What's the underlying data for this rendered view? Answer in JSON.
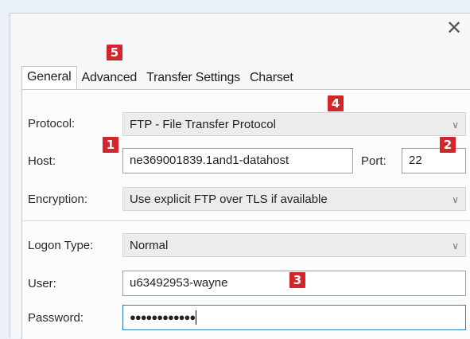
{
  "window": {
    "close_glyph": "✕"
  },
  "tabs": [
    {
      "label": "General",
      "active": true
    },
    {
      "label": "Advanced"
    },
    {
      "label": "Transfer Settings"
    },
    {
      "label": "Charset"
    }
  ],
  "form": {
    "protocol": {
      "label": "Protocol:",
      "value": "FTP - File Transfer Protocol"
    },
    "host": {
      "label": "Host:",
      "value": "ne369001839.1and1-datahost"
    },
    "port": {
      "label": "Port:",
      "value": "22"
    },
    "encryption": {
      "label": "Encryption:",
      "value": "Use explicit FTP over TLS if available"
    },
    "logon_type": {
      "label": "Logon Type:",
      "value": "Normal"
    },
    "user": {
      "label": "User:",
      "value": "u63492953-wayne"
    },
    "password": {
      "label": "Password:",
      "value": "●●●●●●●●●●●●"
    }
  },
  "callouts": {
    "one": "1",
    "two": "2",
    "three": "3",
    "four": "4",
    "five": "5"
  },
  "icons": {
    "close": "close-icon",
    "dropdown": "chevron-down-icon"
  },
  "colors": {
    "callout": "#d3252b",
    "focus": "#2f7cc4"
  }
}
